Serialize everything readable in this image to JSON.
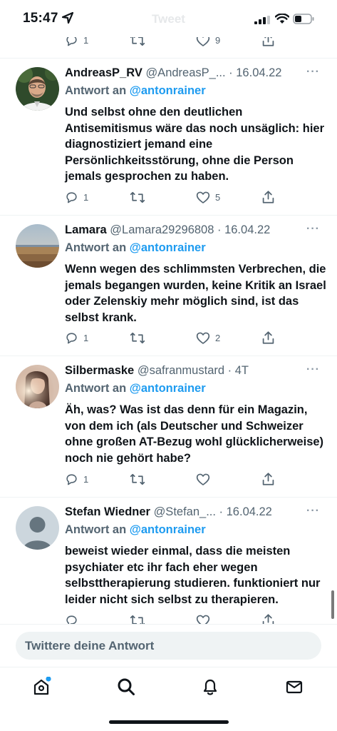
{
  "status_bar": {
    "time": "15:47",
    "faded_title": "Tweet"
  },
  "colors": {
    "accent": "#1d9bf0",
    "text_primary": "#0f1419",
    "text_secondary": "#536471",
    "divider": "#eff3f4",
    "notification_dot": "#1d9bf0"
  },
  "top_actions": {
    "replies": "1",
    "retweets": "",
    "likes": "9"
  },
  "tweets": [
    {
      "name": "AndreasP_RV",
      "handle": "@AndreasP_...",
      "date": "· 16.04.22",
      "reply_prefix": "Antwort an",
      "reply_to": "@antonrainer",
      "text": "Und selbst ohne den deutlichen Antisemitismus wäre das noch unsäglich: hier diagnostiziert jemand eine Persönlichkeitsstörung, ohne die Person jemals gesprochen zu haben.",
      "replies": "1",
      "retweets": "",
      "likes": "5",
      "avatar_icon": "portrait-photo"
    },
    {
      "name": "Lamara",
      "handle": "@Lamara29296808",
      "date": "· 16.04.22",
      "reply_prefix": "Antwort an",
      "reply_to": "@antonrainer",
      "text": "Wenn wegen des schlimmsten Verbrechen, die jemals begangen wurden, keine Kritik an Israel oder Zelenskiy mehr möglich sind, ist das selbst krank.",
      "replies": "1",
      "retweets": "",
      "likes": "2",
      "avatar_icon": "landscape-photo"
    },
    {
      "name": "Silbermaske",
      "handle": "@safranmustard",
      "date": "· 4T",
      "reply_prefix": "Antwort an",
      "reply_to": "@antonrainer",
      "text": "Äh, was? Was ist das denn für ein Magazin, von dem ich (als Deutscher und Schweizer ohne großen AT-Bezug wohl glücklicherweise) noch nie gehört habe?",
      "replies": "1",
      "retweets": "",
      "likes": "",
      "avatar_icon": "portrait-photo"
    },
    {
      "name": "Stefan Wiedner",
      "handle": "@Stefan_...",
      "date": "· 16.04.22",
      "reply_prefix": "Antwort an",
      "reply_to": "@antonrainer",
      "text": "beweist wieder einmal, dass die meisten psychiater etc ihr fach eher wegen selbsttherapierung studieren. funktioniert nur leider nicht sich selbst zu therapieren.",
      "replies": "",
      "retweets": "",
      "likes": "",
      "avatar_icon": "default-avatar"
    }
  ],
  "reply_bar": {
    "placeholder": "Twittere deine Antwort"
  },
  "tabbar": {
    "items": [
      "home-icon",
      "search-icon",
      "bell-icon",
      "mail-icon"
    ]
  }
}
